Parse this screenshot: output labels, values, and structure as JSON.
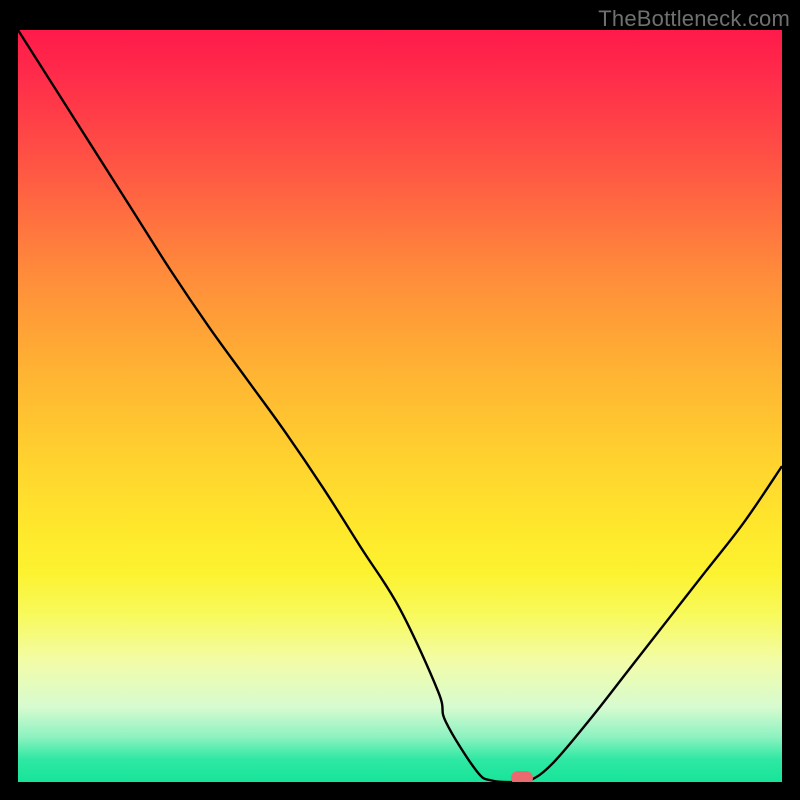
{
  "watermark": "TheBottleneck.com",
  "colors": {
    "marker": "#ea6a6f"
  },
  "chart_data": {
    "type": "line",
    "title": "",
    "xlabel": "",
    "ylabel": "",
    "x": [
      0,
      5,
      10,
      15,
      20,
      25,
      30,
      35,
      40,
      45,
      50,
      55,
      56,
      60,
      62,
      65,
      67,
      70,
      75,
      80,
      85,
      90,
      95,
      100
    ],
    "values": [
      100,
      92,
      84,
      76,
      68,
      60.5,
      53.5,
      46.5,
      39,
      31,
      23,
      12,
      8,
      1.5,
      0.2,
      0,
      0.2,
      2.5,
      8.5,
      15,
      21.5,
      28,
      34.5,
      42
    ],
    "xlim": [
      0,
      100
    ],
    "ylim": [
      0,
      100
    ],
    "marker": {
      "x": 66,
      "y": 0.5
    },
    "note": "x is horizontal position as percent of plot width; values are percent of plot height from bottom (0 = bottom green band, 100 = top red band)."
  }
}
